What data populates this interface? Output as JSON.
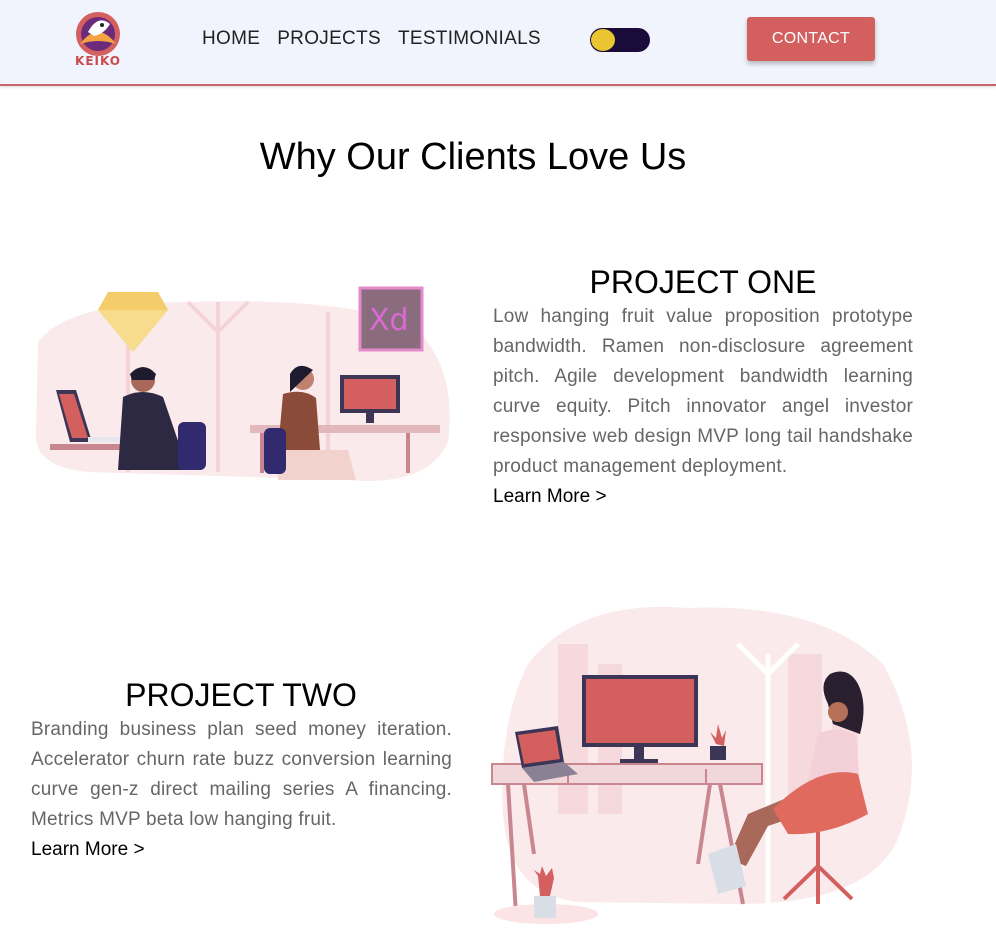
{
  "header": {
    "logo_text": "KEIKO",
    "nav": [
      "HOME",
      "PROJECTS",
      "TESTIMONIALS"
    ],
    "theme_toggle": "dark-mode-toggle",
    "contact_label": "CONTACT"
  },
  "main": {
    "title": "Why Our Clients Love Us",
    "projects": [
      {
        "title": "PROJECT ONE",
        "description": "Low hanging fruit value proposition prototype bandwidth. Ramen non-disclosure agreement pitch. Agile development bandwidth learning curve equity. Pitch innovator angel investor responsive web design MVP long tail handshake product management deployment.",
        "link": "Learn More >",
        "illustration_badge": "Xd"
      },
      {
        "title": "PROJECT TWO",
        "description": "Branding business plan seed money iteration. Accelerator churn rate buzz conversion learning curve gen-z direct mailing series A financing. Metrics MVP beta low hanging fruit.",
        "link": "Learn More >"
      }
    ]
  },
  "colors": {
    "accent": "#d35f5f",
    "header_bg": "#f2f4fd",
    "toggle_bg": "#1a0b3a",
    "toggle_knob": "#e8c531"
  }
}
